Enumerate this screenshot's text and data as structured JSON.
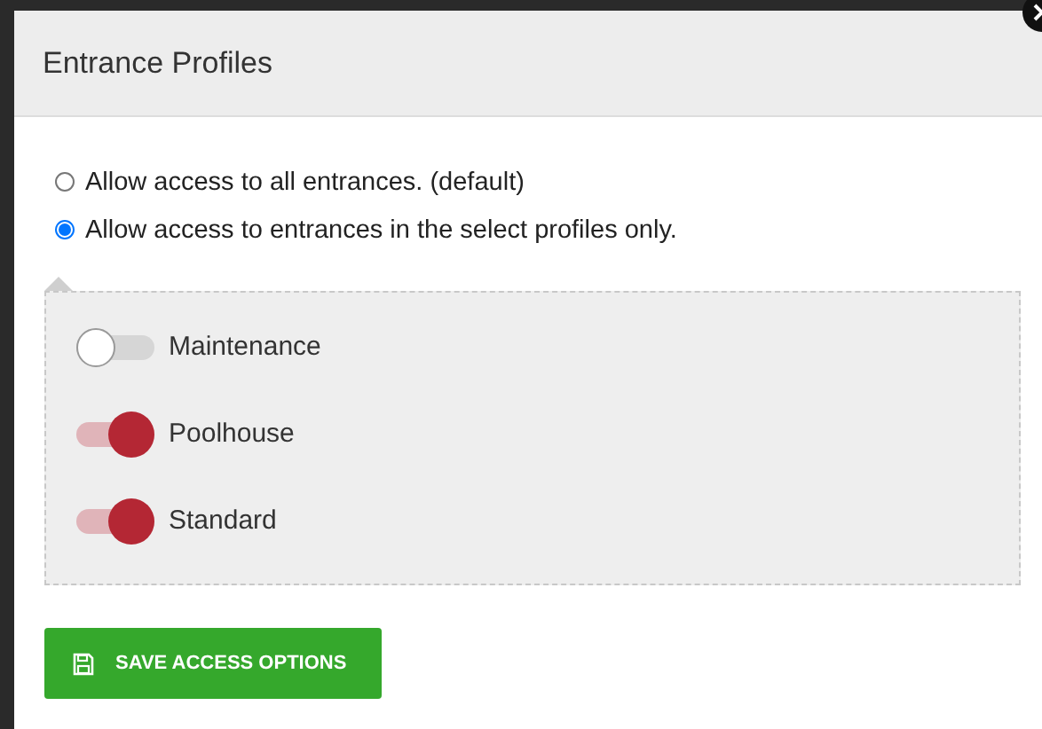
{
  "dialog": {
    "title": "Entrance Profiles"
  },
  "access_options": [
    {
      "label": "Allow access to all entrances. (default)",
      "selected": false
    },
    {
      "label": "Allow access to entrances in the select profiles only.",
      "selected": true
    }
  ],
  "profiles": [
    {
      "name": "Maintenance",
      "on": false
    },
    {
      "name": "Poolhouse",
      "on": true
    },
    {
      "name": "Standard",
      "on": true
    }
  ],
  "save_button": {
    "label": "SAVE ACCESS OPTIONS"
  }
}
